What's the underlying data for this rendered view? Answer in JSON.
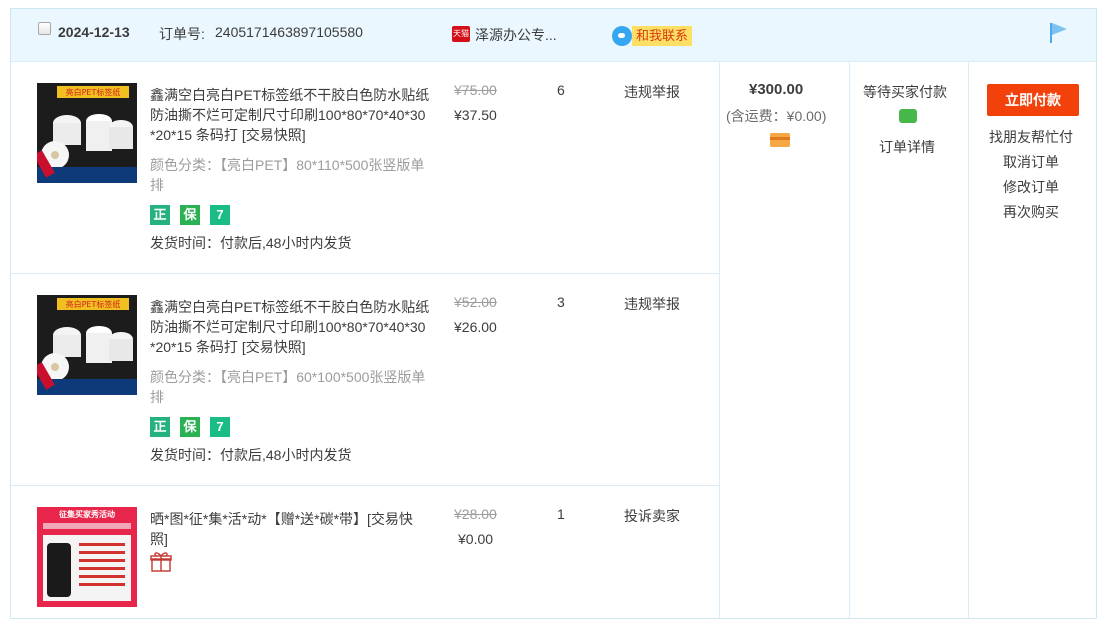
{
  "order": {
    "date": "2024-12-13",
    "order_no_label": "订单号:",
    "order_no": "2405171463897105580",
    "shop_badge": "天猫",
    "shop_name": "泽源办公专...",
    "contact_label": "和我联系",
    "total": "¥300.00",
    "shipping": "(含运费：¥0.00)",
    "status": "等待买家付款",
    "detail_label": "订单详情",
    "pay_button": "立即付款",
    "actions": [
      "找朋友帮忙付",
      "取消订单",
      "修改订单",
      "再次购买"
    ]
  },
  "items": [
    {
      "title": "鑫满空白亮白PET标签纸不干胶白色防水贴纸防油撕不烂可定制尺寸印刷100*80*70*40*30*20*15 条码打 [交易快照]",
      "sku": "颜色分类：【亮白PET】80*110*500张竖版单排",
      "badges": [
        "正",
        "保",
        "7"
      ],
      "ship_time": "发货时间：付款后,48小时内发货",
      "original_price": "¥75.00",
      "price": "¥37.50",
      "qty": "6",
      "service": "违规举报"
    },
    {
      "title": "鑫满空白亮白PET标签纸不干胶白色防水贴纸防油撕不烂可定制尺寸印刷100*80*70*40*30*20*15 条码打 [交易快照]",
      "sku": "颜色分类：【亮白PET】60*100*500张竖版单排",
      "badges": [
        "正",
        "保",
        "7"
      ],
      "ship_time": "发货时间：付款后,48小时内发货",
      "original_price": "¥52.00",
      "price": "¥26.00",
      "qty": "3",
      "service": "违规举报"
    },
    {
      "title": "晒*图*征*集*活*动*【赠*送*碳*带】[交易快照]",
      "original_price": "¥28.00",
      "price": "¥0.00",
      "qty": "1",
      "service": "投诉卖家"
    }
  ],
  "images": {
    "label_top": "亮白PET标签纸",
    "promo_title": "征集买家秀活动"
  },
  "colors": {
    "header_bg": "#eaf7fe",
    "border": "#cfe7f3",
    "pay_button": "#f3410b",
    "strike": "#9c9c9c"
  }
}
